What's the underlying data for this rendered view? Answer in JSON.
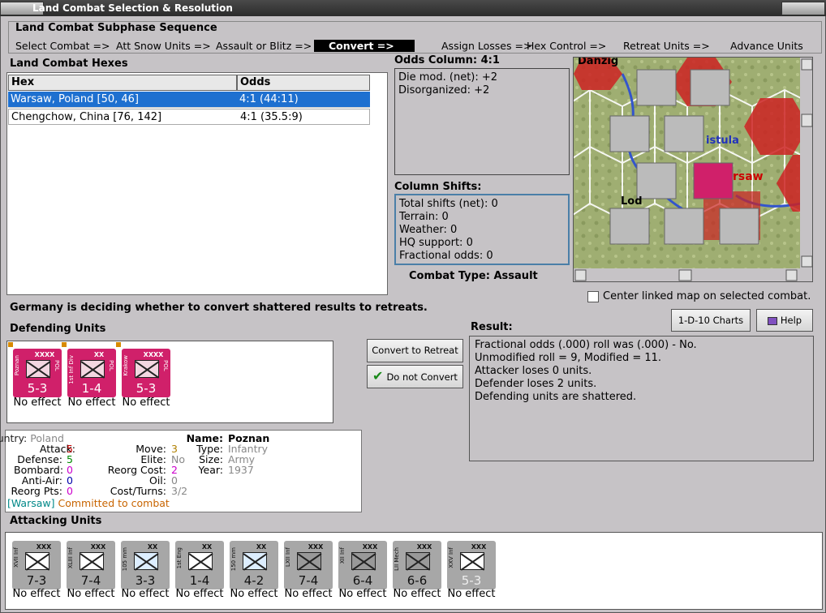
{
  "window": {
    "title": "Land Combat Selection & Resolution"
  },
  "sequence": {
    "title": "Land Combat Subphase Sequence",
    "steps": [
      "Select Combat =>",
      "Att Snow Units =>",
      "Assault or Blitz =>",
      "Convert =>",
      "Assign Losses =>",
      "Hex Control =>",
      "Retreat Units =>",
      "Advance Units"
    ],
    "current": "Convert =>"
  },
  "hexes": {
    "title": "Land Combat Hexes",
    "columns": [
      "Hex",
      "Odds"
    ],
    "rows": [
      {
        "hex": "Warsaw, Poland [50, 46]",
        "odds": "4:1 (44:11)"
      },
      {
        "hex": "Chengchow, China [76, 142]",
        "odds": "4:1 (35.5:9)"
      }
    ]
  },
  "odds": {
    "title": "Odds Column: 4:1",
    "die_mod": "Die mod. (net): +2",
    "disorganized": "Disorganized: +2"
  },
  "shifts": {
    "title": "Column Shifts:",
    "total": "Total shifts (net): 0",
    "terrain": "Terrain: 0",
    "weather": "Weather: 0",
    "hq": "HQ support: 0",
    "fractional": "Fractional odds: 0"
  },
  "combat_type": {
    "label": "Combat Type:",
    "value": "Assault"
  },
  "map": {
    "labels": [
      "Danzig",
      "istula",
      "rsaw",
      "Lod"
    ],
    "center_checkbox": "Center linked map on selected combat.",
    "checked": false
  },
  "status_message": "Germany is deciding whether to convert shattered results to retreats.",
  "buttons": {
    "charts": "1-D-10 Charts",
    "help": "Help",
    "convert": "Convert to Retreat",
    "no_convert": "Do not Convert"
  },
  "defending": {
    "title": "Defending Units",
    "units": [
      {
        "name": "Poznan",
        "size": "XXXX",
        "nat": "POL",
        "str": "5-3",
        "effect": "No effect"
      },
      {
        "name": "1st Inf Div",
        "size": "XX",
        "nat": "POL",
        "str": "1-4",
        "effect": "No effect"
      },
      {
        "name": "Krakow",
        "size": "XXXX",
        "nat": "POL",
        "str": "5-3",
        "effect": "No effect"
      }
    ]
  },
  "result": {
    "title": "Result:",
    "lines": [
      "Fractional odds (.000) roll was (.000)  - No.",
      "Unmodified roll = 9, Modified = 11.",
      "Attacker loses 0 units.",
      "Defender loses 2 units.",
      "Defending units are shattered."
    ]
  },
  "info": {
    "country_label": "Country:",
    "country": "Poland",
    "attack_label": "Attack:",
    "attack": "5",
    "defense_label": "Defense:",
    "defense": "5",
    "bombard_label": "Bombard:",
    "bombard": "0",
    "antiair_label": "Anti-Air:",
    "antiair": "0",
    "reorgpts_label": "Reorg Pts:",
    "reorgpts": "0",
    "location": "[Warsaw]",
    "status": "Committed to combat",
    "move_label": "Move:",
    "move": "3",
    "elite_label": "Elite:",
    "elite": "No",
    "reorgcost_label": "Reorg Cost:",
    "reorgcost": "2",
    "oil_label": "Oil:",
    "oil": "0",
    "costturns_label": "Cost/Turns:",
    "costturns": "3/2",
    "name_label": "Name:",
    "name": "Poznan",
    "type_label": "Type:",
    "type": "Infantry",
    "size_label": "Size:",
    "size": "Army",
    "year_label": "Year:",
    "year": "1937"
  },
  "attacking": {
    "title": "Attacking Units",
    "units": [
      {
        "name": "XVII Inf",
        "size": "XXX",
        "str": "7-3",
        "effect": "No effect"
      },
      {
        "name": "XLIII Inf",
        "size": "XXX",
        "str": "7-4",
        "effect": "No effect"
      },
      {
        "name": "105 mm",
        "size": "XX",
        "str": "3-3",
        "effect": "No effect"
      },
      {
        "name": "1st Eng",
        "size": "XX",
        "str": "1-4",
        "effect": "No effect"
      },
      {
        "name": "150 mm",
        "size": "XX",
        "str": "4-2",
        "effect": "No effect"
      },
      {
        "name": "LXII Inf",
        "size": "XXX",
        "str": "7-4",
        "effect": "No effect"
      },
      {
        "name": "XII Inf",
        "size": "XXX",
        "str": "6-4",
        "effect": "No effect"
      },
      {
        "name": "LII Mech",
        "size": "XXX",
        "str": "6-6",
        "effect": "No effect"
      },
      {
        "name": "XXV Inf",
        "size": "XXX",
        "str": "5-3",
        "effect": "No effect"
      }
    ]
  }
}
